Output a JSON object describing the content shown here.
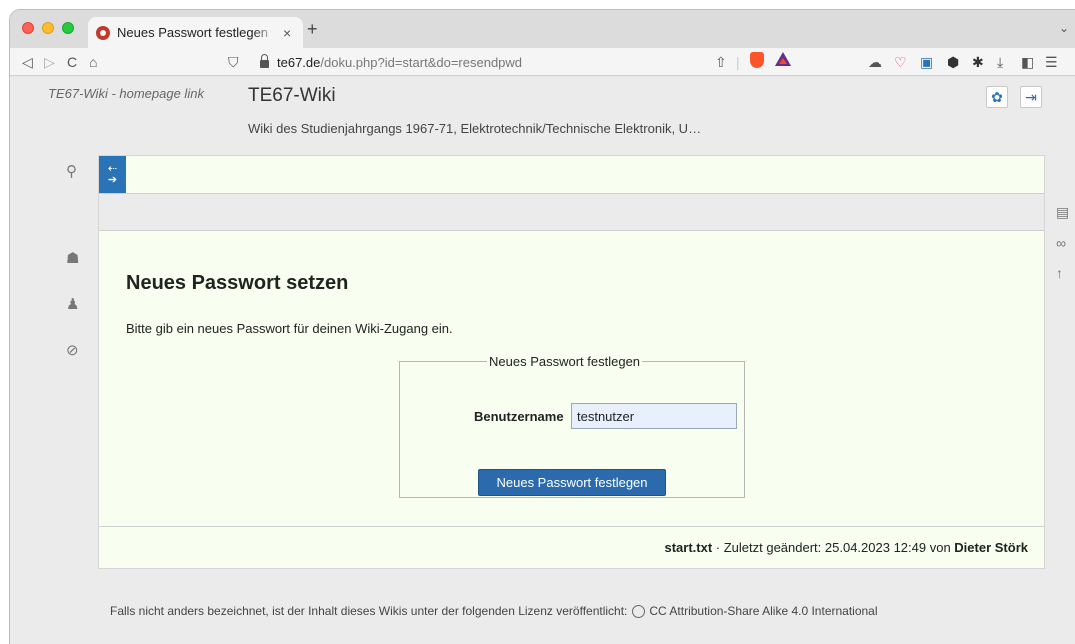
{
  "browser": {
    "tab_title": "Neues Passwort festlegen",
    "tab_close": "×",
    "new_tab": "+",
    "tab_menu": "⌄",
    "nav_back": "◁",
    "nav_forward": "▷",
    "nav_reload": "C",
    "nav_home": "⌂",
    "bookmark": "⛉",
    "url_host": "te67.de",
    "url_path": "/doku.php?id=start&do=resendpwd",
    "share": "⇧",
    "ext_cloud": "☁",
    "ext_pocket": "♡",
    "ext_wallet": "▣",
    "ext_hex": "⬢",
    "ext_puzzle": "✱",
    "download": "⤓",
    "sidebar_toggle": "◧",
    "menu": "☰"
  },
  "header": {
    "logo_alt": "TE67-Wiki - homepage link",
    "site_title": "TE67-Wiki",
    "tagline": "Wiki des Studienjahrgangs 1967-71, Elektrotechnik/Technische Elektronik, U…",
    "settings_glyph": "✿",
    "login_glyph": "⇥"
  },
  "rails": {
    "search": "⚲",
    "sitemap": "☗",
    "user": "♟",
    "compass": "⊘",
    "page": "▤",
    "link": "∞",
    "up": "↑"
  },
  "toggle": {
    "top": "⇠",
    "bottom": "➔"
  },
  "main": {
    "heading": "Neues Passwort setzen",
    "intro": "Bitte gib ein neues Passwort für deinen Wiki-Zugang ein.",
    "form": {
      "legend": "Neues Passwort festlegen",
      "username_label": "Benutzername",
      "username_value": "testnutzer",
      "submit_label": "Neues Passwort festlegen"
    }
  },
  "docinfo": {
    "filename": "start.txt",
    "changed_prefix": " · Zuletzt geändert: 25.04.2023 12:49 von ",
    "author": "Dieter Störk"
  },
  "license": {
    "text": "Falls nicht anders bezeichnet, ist der Inhalt dieses Wikis unter der folgenden Lizenz veröffentlicht:",
    "link": "CC Attribution-Share Alike 4.0 International"
  }
}
